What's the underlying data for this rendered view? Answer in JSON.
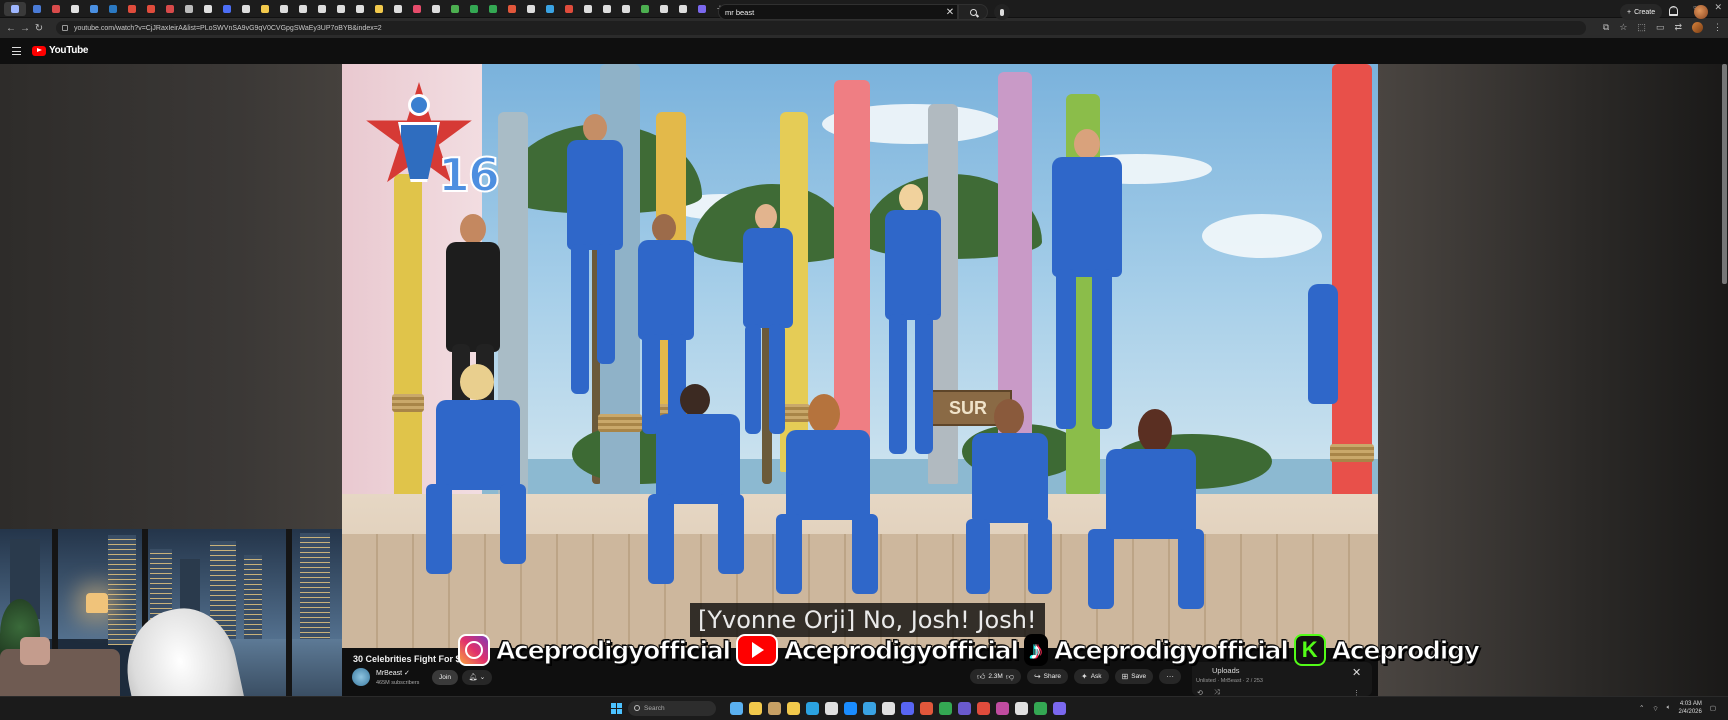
{
  "browser": {
    "tab_favicon_colors": [
      "#9fb7ff",
      "#4a7bd6",
      "#d94b4b",
      "#e0e0e0",
      "#4a90e2",
      "#2b79c2",
      "#e04c3c",
      "#e04c3c",
      "#d84a4a",
      "#bbbbbb",
      "#e0e0e0",
      "#4c6ef5",
      "#dddddd",
      "#f2c94c",
      "#dddddd",
      "#dddddd",
      "#dddddd",
      "#dddddd",
      "#e0e0e0",
      "#f2c94c",
      "#dddddd",
      "#e64c6b",
      "#dddddd",
      "#4caf50",
      "#34a853",
      "#34a853",
      "#e2573b",
      "#dddddd",
      "#3aa3e3",
      "#e04c3c",
      "#dddddd",
      "#dddddd",
      "#dddddd",
      "#4caf50",
      "#dddddd",
      "#dddddd",
      "#7b68ee"
    ],
    "new_tab_label": "+",
    "url": "youtube.com/watch?v=CjJRaxIeirA&list=PLoSWVnSA9vG9qV0CVGpgSWaEy3UP7oBYB&index=2",
    "window_controls": [
      "–",
      "▫",
      "✕"
    ]
  },
  "masthead": {
    "logo_text": "YouTube",
    "search_value": "mr beast",
    "create_label": "Create"
  },
  "video": {
    "episode_badge": "16",
    "sign_text": "SUR",
    "caption": "[Yvonne Orji] No, Josh! Josh!"
  },
  "overlay": {
    "instagram": "Aceprodigyofficial",
    "youtube": "Aceprodigyofficial",
    "tiktok": "Aceprodigyofficial",
    "kick": "Aceprodigy"
  },
  "watch": {
    "title": "30 Celebrities Fight For $",
    "channel_name": "MrBeast ✓",
    "subscribers": "465M subscribers",
    "join_label": "Join",
    "likes": "2.3M",
    "share_label": "Share",
    "ask_label": "Ask",
    "save_label": "Save",
    "more_label": "···"
  },
  "playlist": {
    "title": "Uploads",
    "subtitle": "Unlisted · MrBeast · 2 / 253",
    "close": "✕"
  },
  "taskbar": {
    "search_placeholder": "Search",
    "app_colors": [
      "#5ab0f0",
      "#f2c94c",
      "#c8a165",
      "#f2c94c",
      "#2ba2e0",
      "#e0e0e0",
      "#1a8cff",
      "#3aa3e3",
      "#e0e0e0",
      "#5865f2",
      "#e2573b",
      "#34a853",
      "#6a5acd",
      "#e04c3c",
      "#c04ca0",
      "#e0e0e0",
      "#34a853",
      "#7b68ee"
    ],
    "time": "4:03 AM",
    "date": "2/4/2026"
  },
  "colors": {
    "accent_red": "#ff0000",
    "jersey_blue": "#2f67c9"
  }
}
